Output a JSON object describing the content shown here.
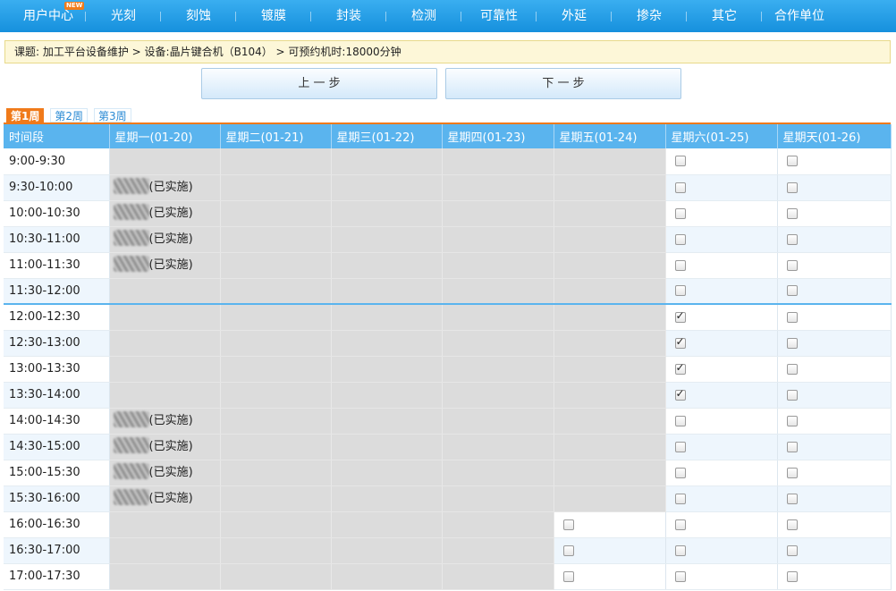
{
  "nav": {
    "items": [
      {
        "label": "用户中心",
        "badge": "NEW"
      },
      {
        "label": "光刻"
      },
      {
        "label": "刻蚀"
      },
      {
        "label": "镀膜"
      },
      {
        "label": "封装"
      },
      {
        "label": "检测"
      },
      {
        "label": "可靠性"
      },
      {
        "label": "外延"
      },
      {
        "label": "掺杂"
      },
      {
        "label": "其它"
      },
      {
        "label": "合作单位"
      }
    ]
  },
  "breadcrumb": "课题: 加工平台设备维护 > 设备:晶片键合机（B104） > 可预约机时:18000分钟",
  "steps": {
    "prev": "上 一 步",
    "next": "下 一 步"
  },
  "week_tabs": [
    "第1周",
    "第2周",
    "第3周"
  ],
  "table": {
    "headers": [
      "时间段",
      "星期一(01-20)",
      "星期二(01-21)",
      "星期三(01-22)",
      "星期四(01-23)",
      "星期五(01-24)",
      "星期六(01-25)",
      "星期天(01-26)"
    ],
    "done_label": "(已实施)",
    "rows": [
      {
        "time": "9:00-9:30",
        "mon": "blocked",
        "fri": "blocked",
        "sat": "open",
        "sun": "open"
      },
      {
        "time": "9:30-10:00",
        "mon": "done",
        "fri": "blocked",
        "sat": "open",
        "sun": "open"
      },
      {
        "time": "10:00-10:30",
        "mon": "done",
        "fri": "blocked",
        "sat": "open",
        "sun": "open"
      },
      {
        "time": "10:30-11:00",
        "mon": "done",
        "fri": "blocked",
        "sat": "open",
        "sun": "open"
      },
      {
        "time": "11:00-11:30",
        "mon": "done",
        "fri": "blocked",
        "sat": "open",
        "sun": "open"
      },
      {
        "time": "11:30-12:00",
        "mon": "blocked",
        "fri": "blocked",
        "sat": "open",
        "sun": "open"
      },
      {
        "time": "12:00-12:30",
        "mon": "blocked",
        "fri": "blocked",
        "sat": "checked",
        "sun": "open"
      },
      {
        "time": "12:30-13:00",
        "mon": "blocked",
        "fri": "blocked",
        "sat": "checked",
        "sun": "open"
      },
      {
        "time": "13:00-13:30",
        "mon": "blocked",
        "fri": "blocked",
        "sat": "checked",
        "sun": "open"
      },
      {
        "time": "13:30-14:00",
        "mon": "blocked",
        "fri": "blocked",
        "sat": "checked",
        "sun": "open"
      },
      {
        "time": "14:00-14:30",
        "mon": "done",
        "fri": "blocked",
        "sat": "open",
        "sun": "open"
      },
      {
        "time": "14:30-15:00",
        "mon": "done",
        "fri": "blocked",
        "sat": "open",
        "sun": "open"
      },
      {
        "time": "15:00-15:30",
        "mon": "done",
        "fri": "blocked",
        "sat": "open",
        "sun": "open"
      },
      {
        "time": "15:30-16:00",
        "mon": "done",
        "fri": "blocked",
        "sat": "open",
        "sun": "open"
      },
      {
        "time": "16:00-16:30",
        "mon": "blocked",
        "fri": "open",
        "sat": "open",
        "sun": "open"
      },
      {
        "time": "16:30-17:00",
        "mon": "blocked",
        "fri": "open",
        "sat": "open",
        "sun": "open"
      },
      {
        "time": "17:00-17:30",
        "mon": "blocked",
        "fri": "open",
        "sat": "open",
        "sun": "open"
      }
    ]
  }
}
